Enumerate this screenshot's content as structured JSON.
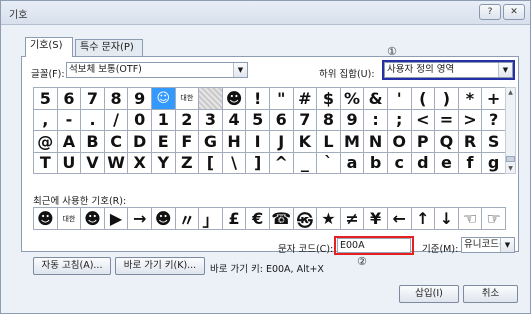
{
  "window": {
    "title": "기호"
  },
  "titlebar": {
    "help": "?",
    "close": "✕"
  },
  "tabs": [
    {
      "label": "기호(S)"
    },
    {
      "label": "특수 문자(P)"
    }
  ],
  "font": {
    "label": "글꼴(F):",
    "value": "석보체 보통(OTF)"
  },
  "subset": {
    "label": "하위 집합(U):",
    "value": "사용자 정의 영역"
  },
  "annotations": {
    "one": "①",
    "two": "②"
  },
  "grid": [
    [
      "5",
      "6",
      "7",
      "8",
      "9",
      "☺",
      "대한",
      "",
      "☻",
      "!",
      "\"",
      "#",
      "$",
      "%",
      "&",
      "'",
      "(",
      ")",
      "*",
      "+"
    ],
    [
      ",",
      "-",
      ".",
      "/",
      "0",
      "1",
      "2",
      "3",
      "4",
      "5",
      "6",
      "7",
      "8",
      "9",
      ":",
      ";",
      "<",
      "=",
      ">",
      "?"
    ],
    [
      "@",
      "A",
      "B",
      "C",
      "D",
      "E",
      "F",
      "G",
      "H",
      "I",
      "J",
      "K",
      "L",
      "M",
      "N",
      "O",
      "P",
      "Q",
      "R",
      "S"
    ],
    [
      "T",
      "U",
      "V",
      "W",
      "X",
      "Y",
      "Z",
      "[",
      "\\",
      "]",
      "^",
      "_",
      "`",
      "a",
      "b",
      "c",
      "d",
      "e",
      "f",
      "g"
    ]
  ],
  "recent": {
    "label": "최근에 사용한 기호(R):",
    "symbols": [
      "☻",
      "대한",
      "☻",
      "▶",
      "→",
      "☻",
      "〃",
      "」",
      "£",
      "€",
      "☎",
      "㉿",
      "★",
      "≠",
      "¥",
      "←",
      "↑",
      "↓",
      "☜",
      "☞"
    ]
  },
  "charcode": {
    "label": "문자 코드(C):",
    "value": "E00A"
  },
  "basis": {
    "label": "기준(M):",
    "value": "유니코드(16진수)"
  },
  "buttons": {
    "autocorrect": "자동 고침(A)...",
    "shortcut": "바로 가기 키(K)...",
    "shortcut_info": "바로 가기 키: E00A, Alt+X",
    "insert": "삽입(I)",
    "cancel": "취소"
  }
}
